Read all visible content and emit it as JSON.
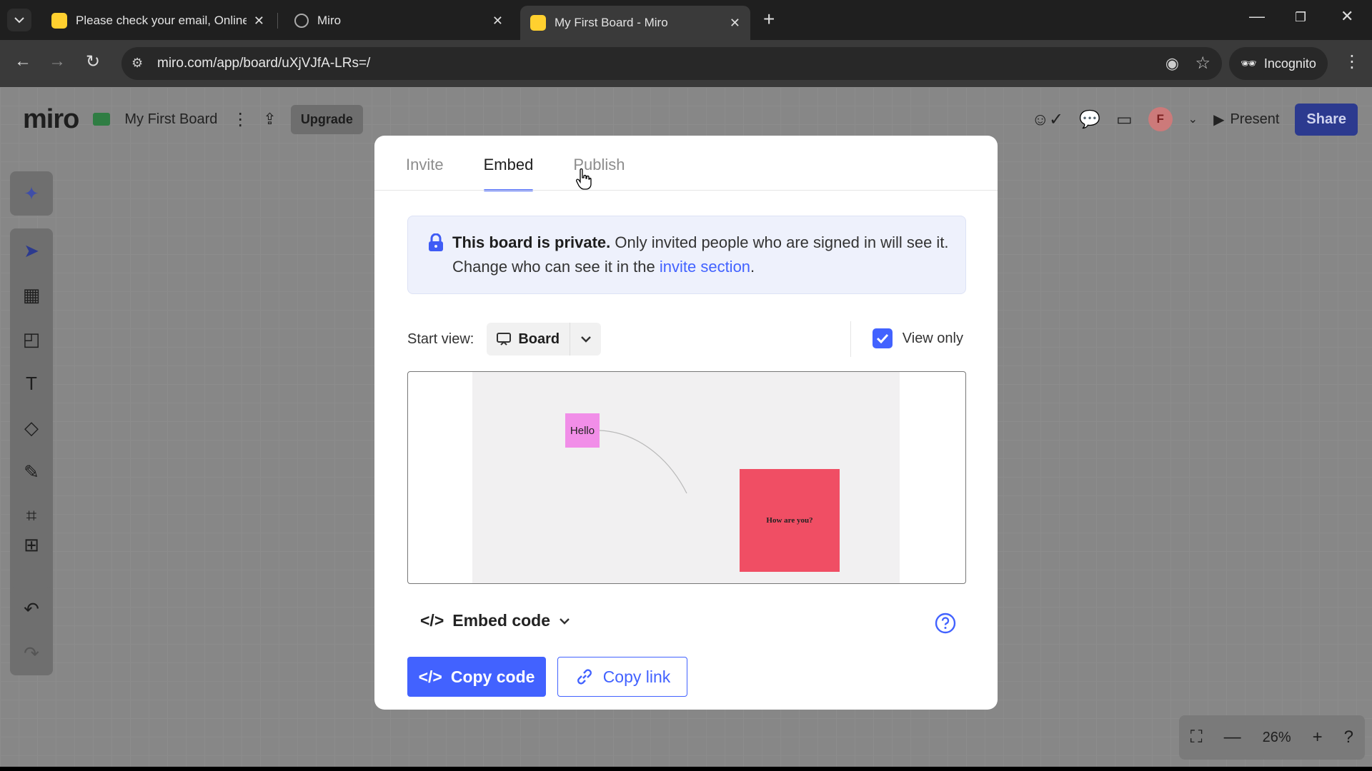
{
  "browser": {
    "tabs": [
      {
        "title": "Please check your email, Online",
        "favicon": "miro-favicon"
      },
      {
        "title": "Miro",
        "favicon": "globe-icon"
      },
      {
        "title": "My First Board - Miro",
        "favicon": "miro-favicon",
        "active": true
      }
    ],
    "url": "miro.com/app/board/uXjVJfA-LRs=/",
    "incognito_label": "Incognito"
  },
  "app": {
    "logo": "miro",
    "board_name": "My First Board",
    "upgrade_label": "Upgrade",
    "avatar_initial": "F",
    "present_label": "Present",
    "share_label": "Share",
    "zoom_level": "26%"
  },
  "dialog": {
    "tabs": [
      "Invite",
      "Embed",
      "Publish"
    ],
    "active_tab": "Embed",
    "notice": {
      "bold": "This board is private.",
      "text": " Only invited people who are signed in will see it. Change who can see it in the ",
      "link": "invite section",
      "end": "."
    },
    "start_view_label": "Start view:",
    "start_view_value": "Board",
    "view_only_label": "View only",
    "view_only_checked": true,
    "preview": {
      "sticky1": "Hello",
      "sticky2": "How are you?"
    },
    "embed_code_label": "Embed code",
    "copy_code_label": "Copy code",
    "copy_link_label": "Copy link"
  },
  "colors": {
    "accent": "#4262ff",
    "share_button": "#2c3a8f",
    "sticky_pink": "#f18ee8",
    "sticky_red": "#f04e64"
  }
}
